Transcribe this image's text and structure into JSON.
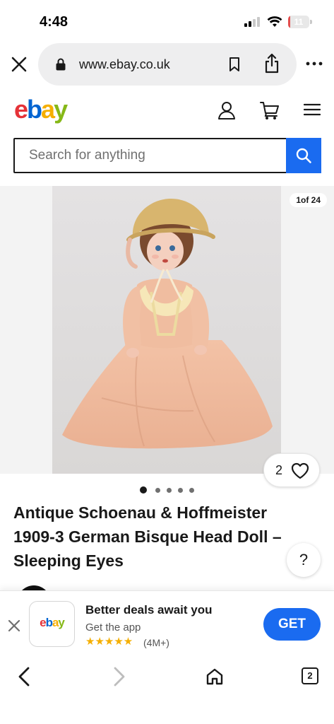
{
  "status_bar": {
    "time": "4:48",
    "battery_level": "11",
    "battery_fraction": 0.11
  },
  "browser": {
    "url": "www.ebay.co.uk"
  },
  "search": {
    "placeholder": "Search for anything"
  },
  "gallery": {
    "counter": "1of 24",
    "watch_count": "2",
    "dots_total": 5,
    "dots_active_index": 0
  },
  "item": {
    "title": "Antique Schoenau & Hoffmeister 1909-3 German Bisque Head Doll – Sleeping Eyes"
  },
  "help": {
    "label": "?"
  },
  "app_banner": {
    "logo": "ebay",
    "headline": "Better deals await you",
    "subtext": "Get the app",
    "stars": "★★★★★",
    "rating_count": "(4M+)",
    "button_label": "GET"
  },
  "toolbar": {
    "tabs_count": "2"
  },
  "colors": {
    "accent_blue": "#1a6bf0",
    "logo_red": "#e53238",
    "logo_blue": "#0064d2",
    "logo_yellow": "#f5af02",
    "logo_green": "#86b817"
  }
}
